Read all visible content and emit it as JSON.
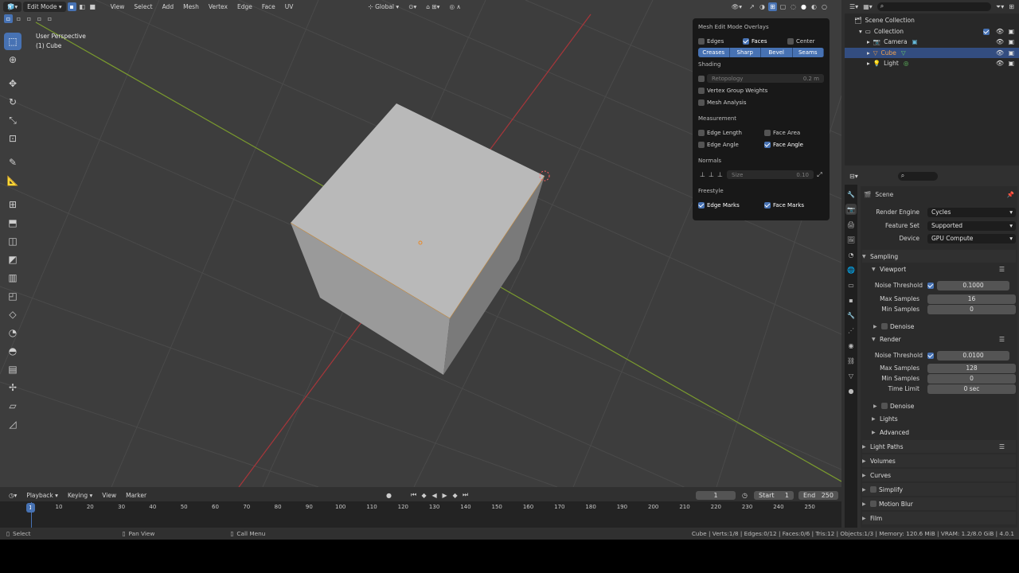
{
  "viewport_header": {
    "mode": "Edit Mode",
    "menus": [
      "View",
      "Select",
      "Add",
      "Mesh",
      "Vertex",
      "Edge",
      "Face",
      "UV"
    ],
    "orientation": "Global"
  },
  "viewport_info": {
    "perspective": "User Perspective",
    "object": "(1) Cube"
  },
  "overlays": {
    "title": "Mesh Edit Mode Overlays",
    "display_items": [
      {
        "label": "Edges",
        "checked": false
      },
      {
        "label": "Faces",
        "checked": true
      },
      {
        "label": "Center",
        "checked": false
      }
    ],
    "mark_buttons": [
      "Creases",
      "Sharp",
      "Bevel",
      "Seams"
    ],
    "shading_title": "Shading",
    "retopology": {
      "label": "Retopology",
      "value": "0.2 m",
      "checked": false
    },
    "vertex_group_weights": {
      "label": "Vertex Group Weights",
      "checked": false
    },
    "mesh_analysis": {
      "label": "Mesh Analysis",
      "checked": false
    },
    "measurement_title": "Measurement",
    "measurement": [
      {
        "label": "Edge Length",
        "checked": false
      },
      {
        "label": "Face Area",
        "checked": false
      },
      {
        "label": "Edge Angle",
        "checked": false
      },
      {
        "label": "Face Angle",
        "checked": true
      }
    ],
    "normals_title": "Normals",
    "normals_size": {
      "label": "Size",
      "value": "0.10"
    },
    "freestyle_title": "Freestyle",
    "freestyle": [
      {
        "label": "Edge Marks",
        "checked": true
      },
      {
        "label": "Face Marks",
        "checked": true
      }
    ]
  },
  "outliner": {
    "root": "Scene Collection",
    "collection": "Collection",
    "items": [
      {
        "label": "Camera",
        "selected": false
      },
      {
        "label": "Cube",
        "selected": true
      },
      {
        "label": "Light",
        "selected": false
      }
    ]
  },
  "properties": {
    "scene_label": "Scene",
    "fields": [
      {
        "label": "Render Engine",
        "value": "Cycles"
      },
      {
        "label": "Feature Set",
        "value": "Supported"
      },
      {
        "label": "Device",
        "value": "GPU Compute"
      }
    ],
    "sampling": "Sampling",
    "viewport": {
      "title": "Viewport",
      "noise_threshold_label": "Noise Threshold",
      "noise_threshold": "0.1000",
      "max_samples_label": "Max Samples",
      "max_samples": "16",
      "min_samples_label": "Min Samples",
      "min_samples": "0",
      "denoise": "Denoise"
    },
    "render": {
      "title": "Render",
      "noise_threshold_label": "Noise Threshold",
      "noise_threshold": "0.0100",
      "max_samples_label": "Max Samples",
      "max_samples": "128",
      "min_samples_label": "Min Samples",
      "min_samples": "0",
      "time_limit_label": "Time Limit",
      "time_limit": "0 sec",
      "denoise": "Denoise"
    },
    "lights": "Lights",
    "advanced": "Advanced",
    "panels": [
      "Light Paths",
      "Volumes",
      "Curves",
      "Simplify",
      "Motion Blur",
      "Film"
    ]
  },
  "timeline": {
    "menus": [
      "Playback",
      "Keying",
      "View",
      "Marker"
    ],
    "current_frame": "1",
    "start_label": "Start",
    "start": "1",
    "end_label": "End",
    "end": "250",
    "ruler_current": "1",
    "ruler": [
      "10",
      "20",
      "30",
      "40",
      "50",
      "60",
      "70",
      "80",
      "90",
      "100",
      "110",
      "120",
      "130",
      "140",
      "150",
      "160",
      "170",
      "180",
      "190",
      "200",
      "210",
      "220",
      "230",
      "240",
      "250"
    ]
  },
  "statusbar": {
    "select": "Select",
    "pan": "Pan View",
    "call_menu": "Call Menu",
    "stats": "Cube | Verts:1/8 | Edges:0/12 | Faces:0/6 | Tris:12 | Objects:1/3 | Memory: 120.6 MiB | VRAM: 1.2/8.0 GiB | 4.0.1"
  }
}
